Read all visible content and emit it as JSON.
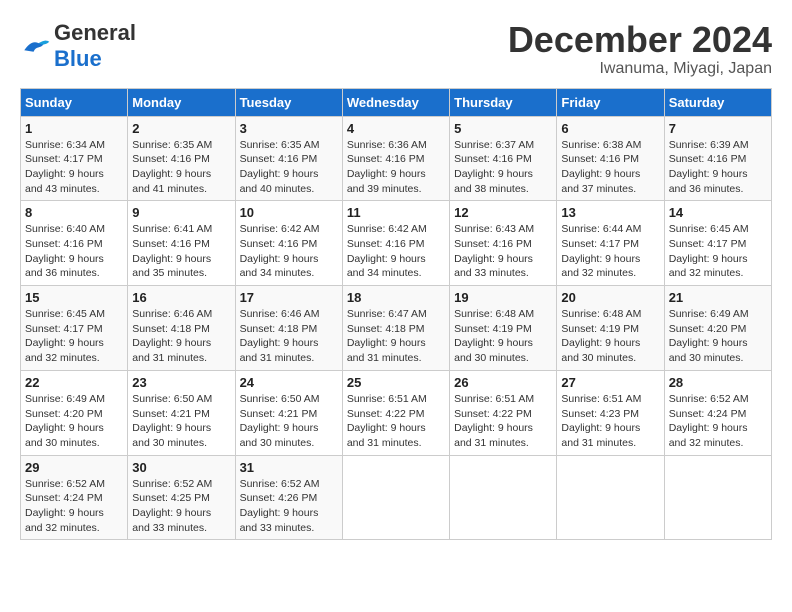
{
  "logo": {
    "general": "General",
    "blue": "Blue"
  },
  "header": {
    "month": "December 2024",
    "location": "Iwanuma, Miyagi, Japan"
  },
  "weekdays": [
    "Sunday",
    "Monday",
    "Tuesday",
    "Wednesday",
    "Thursday",
    "Friday",
    "Saturday"
  ],
  "weeks": [
    [
      {
        "day": "1",
        "sunrise": "6:34 AM",
        "sunset": "4:17 PM",
        "daylight": "9 hours and 43 minutes."
      },
      {
        "day": "2",
        "sunrise": "6:35 AM",
        "sunset": "4:16 PM",
        "daylight": "9 hours and 41 minutes."
      },
      {
        "day": "3",
        "sunrise": "6:35 AM",
        "sunset": "4:16 PM",
        "daylight": "9 hours and 40 minutes."
      },
      {
        "day": "4",
        "sunrise": "6:36 AM",
        "sunset": "4:16 PM",
        "daylight": "9 hours and 39 minutes."
      },
      {
        "day": "5",
        "sunrise": "6:37 AM",
        "sunset": "4:16 PM",
        "daylight": "9 hours and 38 minutes."
      },
      {
        "day": "6",
        "sunrise": "6:38 AM",
        "sunset": "4:16 PM",
        "daylight": "9 hours and 37 minutes."
      },
      {
        "day": "7",
        "sunrise": "6:39 AM",
        "sunset": "4:16 PM",
        "daylight": "9 hours and 36 minutes."
      }
    ],
    [
      {
        "day": "8",
        "sunrise": "6:40 AM",
        "sunset": "4:16 PM",
        "daylight": "9 hours and 36 minutes."
      },
      {
        "day": "9",
        "sunrise": "6:41 AM",
        "sunset": "4:16 PM",
        "daylight": "9 hours and 35 minutes."
      },
      {
        "day": "10",
        "sunrise": "6:42 AM",
        "sunset": "4:16 PM",
        "daylight": "9 hours and 34 minutes."
      },
      {
        "day": "11",
        "sunrise": "6:42 AM",
        "sunset": "4:16 PM",
        "daylight": "9 hours and 34 minutes."
      },
      {
        "day": "12",
        "sunrise": "6:43 AM",
        "sunset": "4:16 PM",
        "daylight": "9 hours and 33 minutes."
      },
      {
        "day": "13",
        "sunrise": "6:44 AM",
        "sunset": "4:17 PM",
        "daylight": "9 hours and 32 minutes."
      },
      {
        "day": "14",
        "sunrise": "6:45 AM",
        "sunset": "4:17 PM",
        "daylight": "9 hours and 32 minutes."
      }
    ],
    [
      {
        "day": "15",
        "sunrise": "6:45 AM",
        "sunset": "4:17 PM",
        "daylight": "9 hours and 32 minutes."
      },
      {
        "day": "16",
        "sunrise": "6:46 AM",
        "sunset": "4:18 PM",
        "daylight": "9 hours and 31 minutes."
      },
      {
        "day": "17",
        "sunrise": "6:46 AM",
        "sunset": "4:18 PM",
        "daylight": "9 hours and 31 minutes."
      },
      {
        "day": "18",
        "sunrise": "6:47 AM",
        "sunset": "4:18 PM",
        "daylight": "9 hours and 31 minutes."
      },
      {
        "day": "19",
        "sunrise": "6:48 AM",
        "sunset": "4:19 PM",
        "daylight": "9 hours and 30 minutes."
      },
      {
        "day": "20",
        "sunrise": "6:48 AM",
        "sunset": "4:19 PM",
        "daylight": "9 hours and 30 minutes."
      },
      {
        "day": "21",
        "sunrise": "6:49 AM",
        "sunset": "4:20 PM",
        "daylight": "9 hours and 30 minutes."
      }
    ],
    [
      {
        "day": "22",
        "sunrise": "6:49 AM",
        "sunset": "4:20 PM",
        "daylight": "9 hours and 30 minutes."
      },
      {
        "day": "23",
        "sunrise": "6:50 AM",
        "sunset": "4:21 PM",
        "daylight": "9 hours and 30 minutes."
      },
      {
        "day": "24",
        "sunrise": "6:50 AM",
        "sunset": "4:21 PM",
        "daylight": "9 hours and 30 minutes."
      },
      {
        "day": "25",
        "sunrise": "6:51 AM",
        "sunset": "4:22 PM",
        "daylight": "9 hours and 31 minutes."
      },
      {
        "day": "26",
        "sunrise": "6:51 AM",
        "sunset": "4:22 PM",
        "daylight": "9 hours and 31 minutes."
      },
      {
        "day": "27",
        "sunrise": "6:51 AM",
        "sunset": "4:23 PM",
        "daylight": "9 hours and 31 minutes."
      },
      {
        "day": "28",
        "sunrise": "6:52 AM",
        "sunset": "4:24 PM",
        "daylight": "9 hours and 32 minutes."
      }
    ],
    [
      {
        "day": "29",
        "sunrise": "6:52 AM",
        "sunset": "4:24 PM",
        "daylight": "9 hours and 32 minutes."
      },
      {
        "day": "30",
        "sunrise": "6:52 AM",
        "sunset": "4:25 PM",
        "daylight": "9 hours and 33 minutes."
      },
      {
        "day": "31",
        "sunrise": "6:52 AM",
        "sunset": "4:26 PM",
        "daylight": "9 hours and 33 minutes."
      },
      null,
      null,
      null,
      null
    ]
  ]
}
